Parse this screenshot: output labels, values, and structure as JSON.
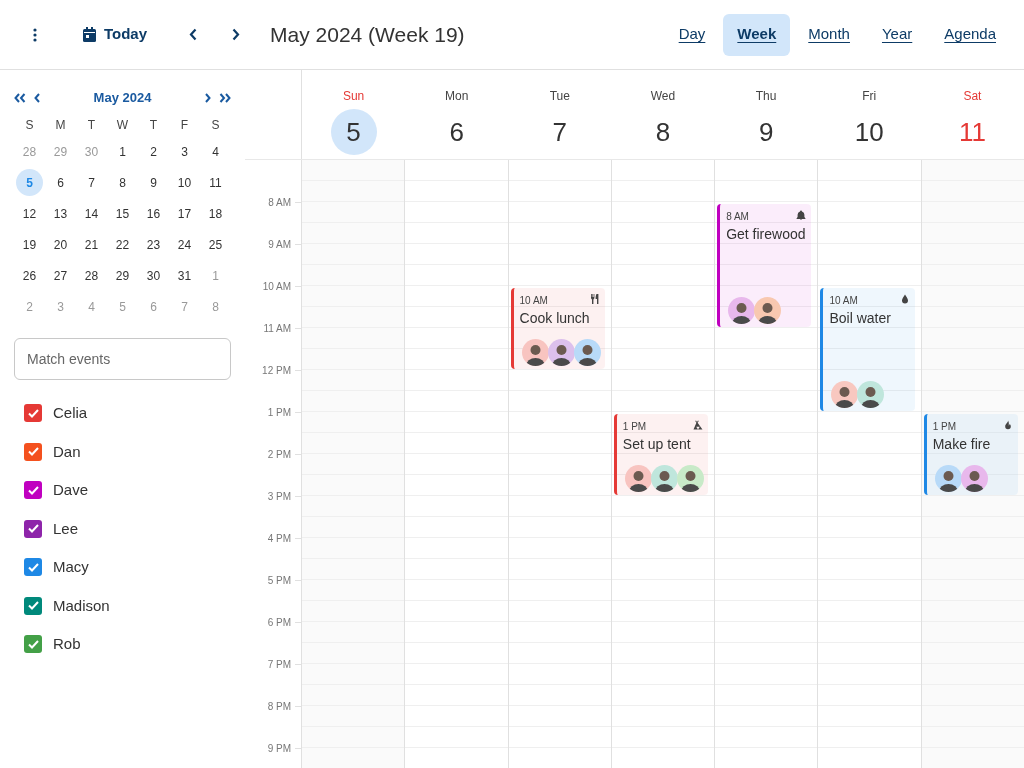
{
  "toolbar": {
    "today": "Today",
    "title": "May 2024 (Week 19)",
    "views": [
      {
        "label": "Day",
        "selected": false
      },
      {
        "label": "Week",
        "selected": true
      },
      {
        "label": "Month",
        "selected": false
      },
      {
        "label": "Year",
        "selected": false
      },
      {
        "label": "Agenda",
        "selected": false
      }
    ]
  },
  "mini_calendar": {
    "title": "May 2024",
    "weekdays": [
      "S",
      "M",
      "T",
      "W",
      "T",
      "F",
      "S"
    ],
    "weeks": [
      [
        {
          "d": "28",
          "outside": true,
          "selected": false
        },
        {
          "d": "29",
          "outside": true,
          "selected": false
        },
        {
          "d": "30",
          "outside": true,
          "selected": false
        },
        {
          "d": "1",
          "outside": false,
          "selected": false
        },
        {
          "d": "2",
          "outside": false,
          "selected": false
        },
        {
          "d": "3",
          "outside": false,
          "selected": false
        },
        {
          "d": "4",
          "outside": false,
          "selected": false
        }
      ],
      [
        {
          "d": "5",
          "outside": false,
          "selected": true
        },
        {
          "d": "6",
          "outside": false,
          "selected": false
        },
        {
          "d": "7",
          "outside": false,
          "selected": false
        },
        {
          "d": "8",
          "outside": false,
          "selected": false
        },
        {
          "d": "9",
          "outside": false,
          "selected": false
        },
        {
          "d": "10",
          "outside": false,
          "selected": false
        },
        {
          "d": "11",
          "outside": false,
          "selected": false
        }
      ],
      [
        {
          "d": "12",
          "outside": false,
          "selected": false
        },
        {
          "d": "13",
          "outside": false,
          "selected": false
        },
        {
          "d": "14",
          "outside": false,
          "selected": false
        },
        {
          "d": "15",
          "outside": false,
          "selected": false
        },
        {
          "d": "16",
          "outside": false,
          "selected": false
        },
        {
          "d": "17",
          "outside": false,
          "selected": false
        },
        {
          "d": "18",
          "outside": false,
          "selected": false
        }
      ],
      [
        {
          "d": "19",
          "outside": false,
          "selected": false
        },
        {
          "d": "20",
          "outside": false,
          "selected": false
        },
        {
          "d": "21",
          "outside": false,
          "selected": false
        },
        {
          "d": "22",
          "outside": false,
          "selected": false
        },
        {
          "d": "23",
          "outside": false,
          "selected": false
        },
        {
          "d": "24",
          "outside": false,
          "selected": false
        },
        {
          "d": "25",
          "outside": false,
          "selected": false
        }
      ],
      [
        {
          "d": "26",
          "outside": false,
          "selected": false
        },
        {
          "d": "27",
          "outside": false,
          "selected": false
        },
        {
          "d": "28",
          "outside": false,
          "selected": false
        },
        {
          "d": "29",
          "outside": false,
          "selected": false
        },
        {
          "d": "30",
          "outside": false,
          "selected": false
        },
        {
          "d": "31",
          "outside": false,
          "selected": false
        },
        {
          "d": "1",
          "outside": true,
          "selected": false
        }
      ],
      [
        {
          "d": "2",
          "outside": true,
          "selected": false
        },
        {
          "d": "3",
          "outside": true,
          "selected": false
        },
        {
          "d": "4",
          "outside": true,
          "selected": false
        },
        {
          "d": "5",
          "outside": true,
          "selected": false
        },
        {
          "d": "6",
          "outside": true,
          "selected": false
        },
        {
          "d": "7",
          "outside": true,
          "selected": false
        },
        {
          "d": "8",
          "outside": true,
          "selected": false
        }
      ]
    ]
  },
  "search": {
    "placeholder": "Match events"
  },
  "people": [
    {
      "name": "Celia",
      "color": "#e53935",
      "checked": true
    },
    {
      "name": "Dan",
      "color": "#f4511e",
      "checked": true
    },
    {
      "name": "Dave",
      "color": "#c000c0",
      "checked": true
    },
    {
      "name": "Lee",
      "color": "#8e24aa",
      "checked": true
    },
    {
      "name": "Macy",
      "color": "#1e88e5",
      "checked": true
    },
    {
      "name": "Madison",
      "color": "#00897b",
      "checked": true
    },
    {
      "name": "Rob",
      "color": "#43a047",
      "checked": true
    }
  ],
  "hours": [
    "8 AM",
    "9 AM",
    "10 AM",
    "11 AM",
    "12 PM",
    "1 PM",
    "2 PM",
    "3 PM",
    "4 PM",
    "5 PM",
    "6 PM",
    "7 PM",
    "8 PM",
    "9 PM"
  ],
  "days": [
    {
      "name": "Sun",
      "date": "5",
      "weekend": true,
      "selected": true,
      "slots": [
        {
          "kind": "free"
        },
        {
          "kind": "free"
        },
        {
          "kind": "free"
        },
        {
          "kind": "free"
        },
        {
          "kind": "free"
        },
        {
          "kind": "free"
        },
        {
          "kind": "free"
        },
        {
          "kind": "free"
        },
        {
          "kind": "free"
        },
        {
          "kind": "free"
        },
        {
          "kind": "free"
        },
        {
          "kind": "free"
        },
        {
          "kind": "free"
        },
        {
          "kind": "free"
        },
        {
          "kind": "free"
        }
      ]
    },
    {
      "name": "Mon",
      "date": "6",
      "weekend": false,
      "selected": false,
      "slots": [
        {
          "kind": "free"
        },
        {
          "kind": "free"
        },
        {
          "kind": "free"
        },
        {
          "kind": "free"
        },
        {
          "kind": "free"
        },
        {
          "kind": "free"
        },
        {
          "kind": "free"
        },
        {
          "kind": "free"
        },
        {
          "kind": "free"
        },
        {
          "kind": "free"
        },
        {
          "kind": "free"
        },
        {
          "kind": "free"
        },
        {
          "kind": "free"
        },
        {
          "kind": "free"
        },
        {
          "kind": "free"
        }
      ]
    },
    {
      "name": "Tue",
      "date": "7",
      "weekend": false,
      "selected": false,
      "slots": [
        {
          "kind": "free"
        },
        {
          "kind": "free"
        },
        {
          "kind": "free"
        },
        {
          "kind": "event",
          "time": "10 AM",
          "title": "Cook lunch",
          "color": "#e53935",
          "attendees": [
            {
              "color": "#f8c4c0"
            },
            {
              "color": "#dcc0ec"
            },
            {
              "color": "#b8daf8"
            }
          ]
        },
        {
          "kind": "continued"
        },
        {
          "kind": "free"
        },
        {
          "kind": "free"
        },
        {
          "kind": "free"
        },
        {
          "kind": "free"
        },
        {
          "kind": "free"
        },
        {
          "kind": "free"
        },
        {
          "kind": "free"
        },
        {
          "kind": "free"
        },
        {
          "kind": "free"
        },
        {
          "kind": "free"
        }
      ]
    },
    {
      "name": "Wed",
      "date": "8",
      "weekend": false,
      "selected": false,
      "slots": [
        {
          "kind": "free"
        },
        {
          "kind": "free"
        },
        {
          "kind": "free"
        },
        {
          "kind": "free"
        },
        {
          "kind": "free"
        },
        {
          "kind": "free"
        },
        {
          "kind": "event",
          "time": "1 PM",
          "title": "Set up tent",
          "color": "#e53935",
          "attendees": [
            {
              "color": "#f8c4c0"
            },
            {
              "color": "#bfe6dc"
            },
            {
              "color": "#c8eac8"
            }
          ]
        },
        {
          "kind": "continued"
        },
        {
          "kind": "free"
        },
        {
          "kind": "free"
        },
        {
          "kind": "free"
        },
        {
          "kind": "free"
        },
        {
          "kind": "free"
        },
        {
          "kind": "free"
        },
        {
          "kind": "free"
        }
      ]
    },
    {
      "name": "Thu",
      "date": "9",
      "weekend": false,
      "selected": false,
      "slots": [
        {
          "kind": "free"
        },
        {
          "kind": "event",
          "time": "8 AM",
          "title": "Get firewood",
          "color": "#c000c0",
          "attendees": [
            {
              "color": "#e8b8ec"
            },
            {
              "color": "#f8c8b0"
            }
          ]
        },
        {
          "kind": "continued"
        },
        {
          "kind": "continued"
        },
        {
          "kind": "free"
        },
        {
          "kind": "free"
        },
        {
          "kind": "free"
        },
        {
          "kind": "free"
        },
        {
          "kind": "free"
        },
        {
          "kind": "free"
        },
        {
          "kind": "free"
        },
        {
          "kind": "free"
        },
        {
          "kind": "free"
        },
        {
          "kind": "free"
        },
        {
          "kind": "free"
        }
      ]
    },
    {
      "name": "Fri",
      "date": "10",
      "weekend": false,
      "selected": false,
      "slots": [
        {
          "kind": "free"
        },
        {
          "kind": "free"
        },
        {
          "kind": "free"
        },
        {
          "kind": "event",
          "time": "10 AM",
          "title": "Boil water",
          "color": "#1e88e5",
          "attendees": [
            {
              "color": "#f8c8c0"
            },
            {
              "color": "#bfe6dc"
            }
          ]
        },
        {
          "kind": "continued"
        },
        {
          "kind": "continued"
        },
        {
          "kind": "free"
        },
        {
          "kind": "free"
        },
        {
          "kind": "free"
        },
        {
          "kind": "free"
        },
        {
          "kind": "free"
        },
        {
          "kind": "free"
        },
        {
          "kind": "free"
        },
        {
          "kind": "free"
        },
        {
          "kind": "free"
        }
      ]
    },
    {
      "name": "Sat",
      "date": "11",
      "weekend": true,
      "selected": false,
      "slots": [
        {
          "kind": "free"
        },
        {
          "kind": "free"
        },
        {
          "kind": "free"
        },
        {
          "kind": "free"
        },
        {
          "kind": "free"
        },
        {
          "kind": "free"
        },
        {
          "kind": "event",
          "time": "1 PM",
          "title": "Make fire",
          "color": "#1e88e5",
          "attendees": [
            {
              "color": "#b8daf8"
            },
            {
              "color": "#e8b8ec"
            }
          ]
        },
        {
          "kind": "continued"
        },
        {
          "kind": "free"
        },
        {
          "kind": "free"
        },
        {
          "kind": "free"
        },
        {
          "kind": "free"
        },
        {
          "kind": "free"
        },
        {
          "kind": "free"
        },
        {
          "kind": "free"
        }
      ]
    }
  ]
}
